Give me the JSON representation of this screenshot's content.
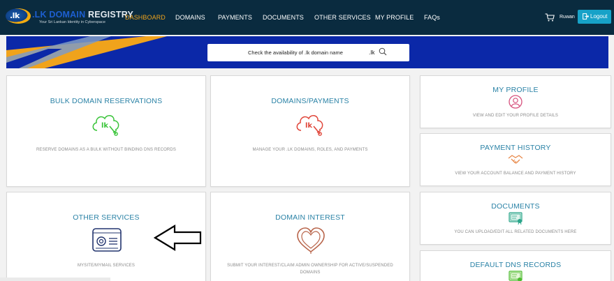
{
  "brand": {
    "badge": ".lk",
    "title_a": ".LK DOMAIN",
    "title_b": "REGISTRY",
    "subtitle": "Your Sri Lankan Identity in Cyberspace"
  },
  "nav": {
    "items": [
      "DASHBOARD",
      "DOMAINS",
      "PAYMENTS",
      "DOCUMENTS",
      "OTHER SERVICES",
      "MY PROFILE",
      "FAQs"
    ],
    "active": "DASHBOARD"
  },
  "header": {
    "user": "Ruwan",
    "logout_label": "Logout"
  },
  "search": {
    "label": "Check the availability of .lk domain name",
    "suffix": ".lk"
  },
  "cards": {
    "bulk": {
      "title": "BULK DOMAIN RESERVATIONS",
      "desc": "RESERVE DOMAINS AS A BULK WITHOUT BINDING DNS RECORDS"
    },
    "domains_payments": {
      "title": "DOMAINS/PAYMENTS",
      "desc": "MANAGE YOUR .LK DOMAINS, ROLES, AND PAYMENTS"
    },
    "other_services": {
      "title": "OTHER SERVICES",
      "desc": "MYSITE/MYMAIL SERVICES"
    },
    "domain_interest": {
      "title": "DOMAIN INTEREST",
      "desc": "SUBMIT YOUR INTEREST/CLAIM ADMIN OWNERSHIP FOR ACTIVE/SUSPENDED DOMAINS"
    },
    "my_profile": {
      "title": "MY PROFILE",
      "desc": "VIEW AND EDIT YOUR PROFILE DETAILS"
    },
    "payment_history": {
      "title": "PAYMENT HISTORY",
      "desc": "VIEW YOUR ACCOUNT BALANCE AND PAYMENT HISTORY"
    },
    "documents": {
      "title": "DOCUMENTS",
      "desc": "YOU CAN UPLOAD/EDIT ALL RELATED DOCUMENTS HERE"
    },
    "dns": {
      "title": "DEFAULT DNS RECORDS"
    }
  },
  "colors": {
    "navbar": "#0a2b3f",
    "active_nav": "#f0a31c",
    "banner": "#0b28a8",
    "card_title": "#2a82a6",
    "logout_button": "#17a2c8",
    "green_icon": "#3ac43a",
    "red_icon": "#e0463a",
    "brown_icon": "#b8644a",
    "navy_icon": "#22346e"
  },
  "icons": {
    "cart": "cart-icon",
    "logout": "logout-icon",
    "search": "search-icon",
    "bulk": "cloud-lk-icon",
    "domains": "cloud-lk-icon",
    "other": "id-card-icon",
    "interest": "heart-icon",
    "profile": "user-circle-icon",
    "payment": "handshake-icon",
    "documents": "certificate-icon",
    "dns": "certificate-icon",
    "annotation": "arrow-left-icon"
  }
}
